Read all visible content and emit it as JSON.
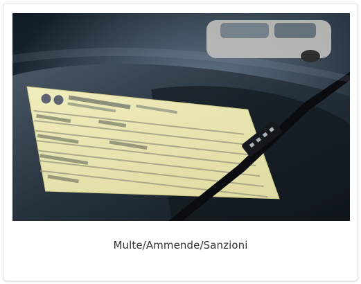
{
  "card": {
    "title": "Multe/Ammende/Sanzioni",
    "image_icon": "parking-ticket-photo"
  },
  "colors": {
    "ticket_paper": "#ece9b4",
    "car_glass": "#1e2a36",
    "caption_text": "#333333"
  }
}
